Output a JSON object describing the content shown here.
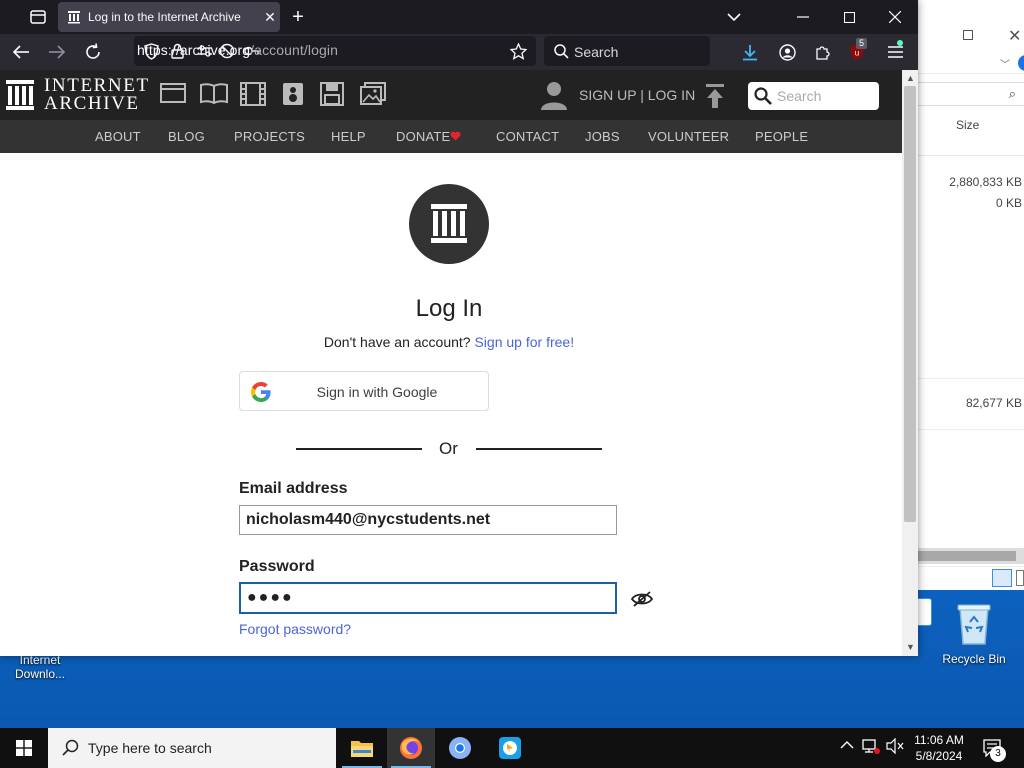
{
  "browser": {
    "tab_title": "Log in to the Internet Archive",
    "url_host": "https://archive.org",
    "url_path": "/account/login",
    "search_placeholder": "Search",
    "extension_badge": "5"
  },
  "ia_header": {
    "logo_line1": "INTERNET",
    "logo_line2": "ARCHIVE",
    "media_icons": [
      "web-icon",
      "texts-icon",
      "video-icon",
      "audio-icon",
      "software-icon",
      "images-icon"
    ],
    "signup_login": "SIGN UP | LOG IN",
    "search_placeholder": "Search",
    "nav": [
      "ABOUT",
      "BLOG",
      "PROJECTS",
      "HELP",
      "DONATE",
      "CONTACT",
      "JOBS",
      "VOLUNTEER",
      "PEOPLE"
    ]
  },
  "login": {
    "title": "Log In",
    "no_account_text": "Don't have an account?",
    "signup_link": "Sign up for free!",
    "google_button": "Sign in with Google",
    "or_text": "Or",
    "email_label": "Email address",
    "email_value": "nicholasm440@nycstudents.net",
    "password_label": "Password",
    "password_value": "●●●●",
    "forgot_link": "Forgot password?"
  },
  "explorer": {
    "column_header": "Size",
    "sizes": [
      "2,880,833 KB",
      "0 KB",
      "82,677 KB"
    ]
  },
  "desktop": {
    "icons": [
      {
        "label_line1": "Internet",
        "label_line2": "Downlo..."
      },
      {
        "label_line1": "Recycle Bin",
        "label_line2": ""
      }
    ]
  },
  "taskbar": {
    "search_placeholder": "Type here to search",
    "time": "11:06 AM",
    "date": "5/8/2024",
    "notification_count": "3"
  },
  "colors": {
    "accent_link": "#4b64d6",
    "focus_border": "#1b5fa9",
    "donate_heart": "#e0262c",
    "firefox_download": "#3fbaf3"
  }
}
